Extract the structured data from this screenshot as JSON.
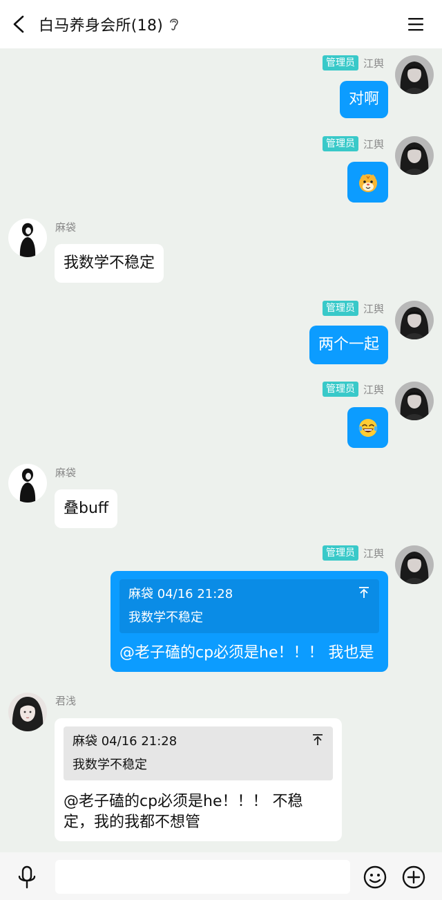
{
  "header": {
    "title": "白马养身会所(18)",
    "back_icon": "chevron-left-icon",
    "ear_icon": "ear-icon",
    "menu_icon": "hamburger-menu-icon"
  },
  "messages": [
    {
      "side": "right",
      "tag": "管理员",
      "sender": "江舆",
      "text": "对啊"
    },
    {
      "side": "right",
      "tag": "管理员",
      "sender": "江舆",
      "sticker": "tiger-face-emoji"
    },
    {
      "side": "left",
      "sender": "麻袋",
      "text": "我数学不稳定"
    },
    {
      "side": "right",
      "tag": "管理员",
      "sender": "江舆",
      "text": "两个一起"
    },
    {
      "side": "right",
      "tag": "管理员",
      "sender": "江舆",
      "sticker": "laughing-tears-emoji"
    },
    {
      "side": "left",
      "sender": "麻袋",
      "text": "叠buff"
    },
    {
      "side": "right",
      "tag": "管理员",
      "sender": "江舆",
      "quote": {
        "author_time": "麻袋 04/16 21:28",
        "text": "我数学不稳定",
        "icon": "jump-to-top-icon"
      },
      "text": "@老子磕的cp必须是he！！！ 我也是"
    },
    {
      "side": "left",
      "sender": "君浅",
      "quote": {
        "author_time": "麻袋 04/16 21:28",
        "text": "我数学不稳定",
        "icon": "jump-to-top-icon"
      },
      "text_line1": "@老子磕的cp必须是he！！！ 不稳",
      "text_line2": "定，我的我都不想管"
    }
  ],
  "input": {
    "placeholder": "",
    "value": ""
  },
  "footer_icons": [
    "microphone-icon",
    "smiley-icon",
    "plus-circle-icon"
  ],
  "colors": {
    "background": "#edf1ed",
    "my_bubble": "#0c9cff",
    "admin_tag": "#39c9c9",
    "other_bubble": "#ffffff"
  }
}
